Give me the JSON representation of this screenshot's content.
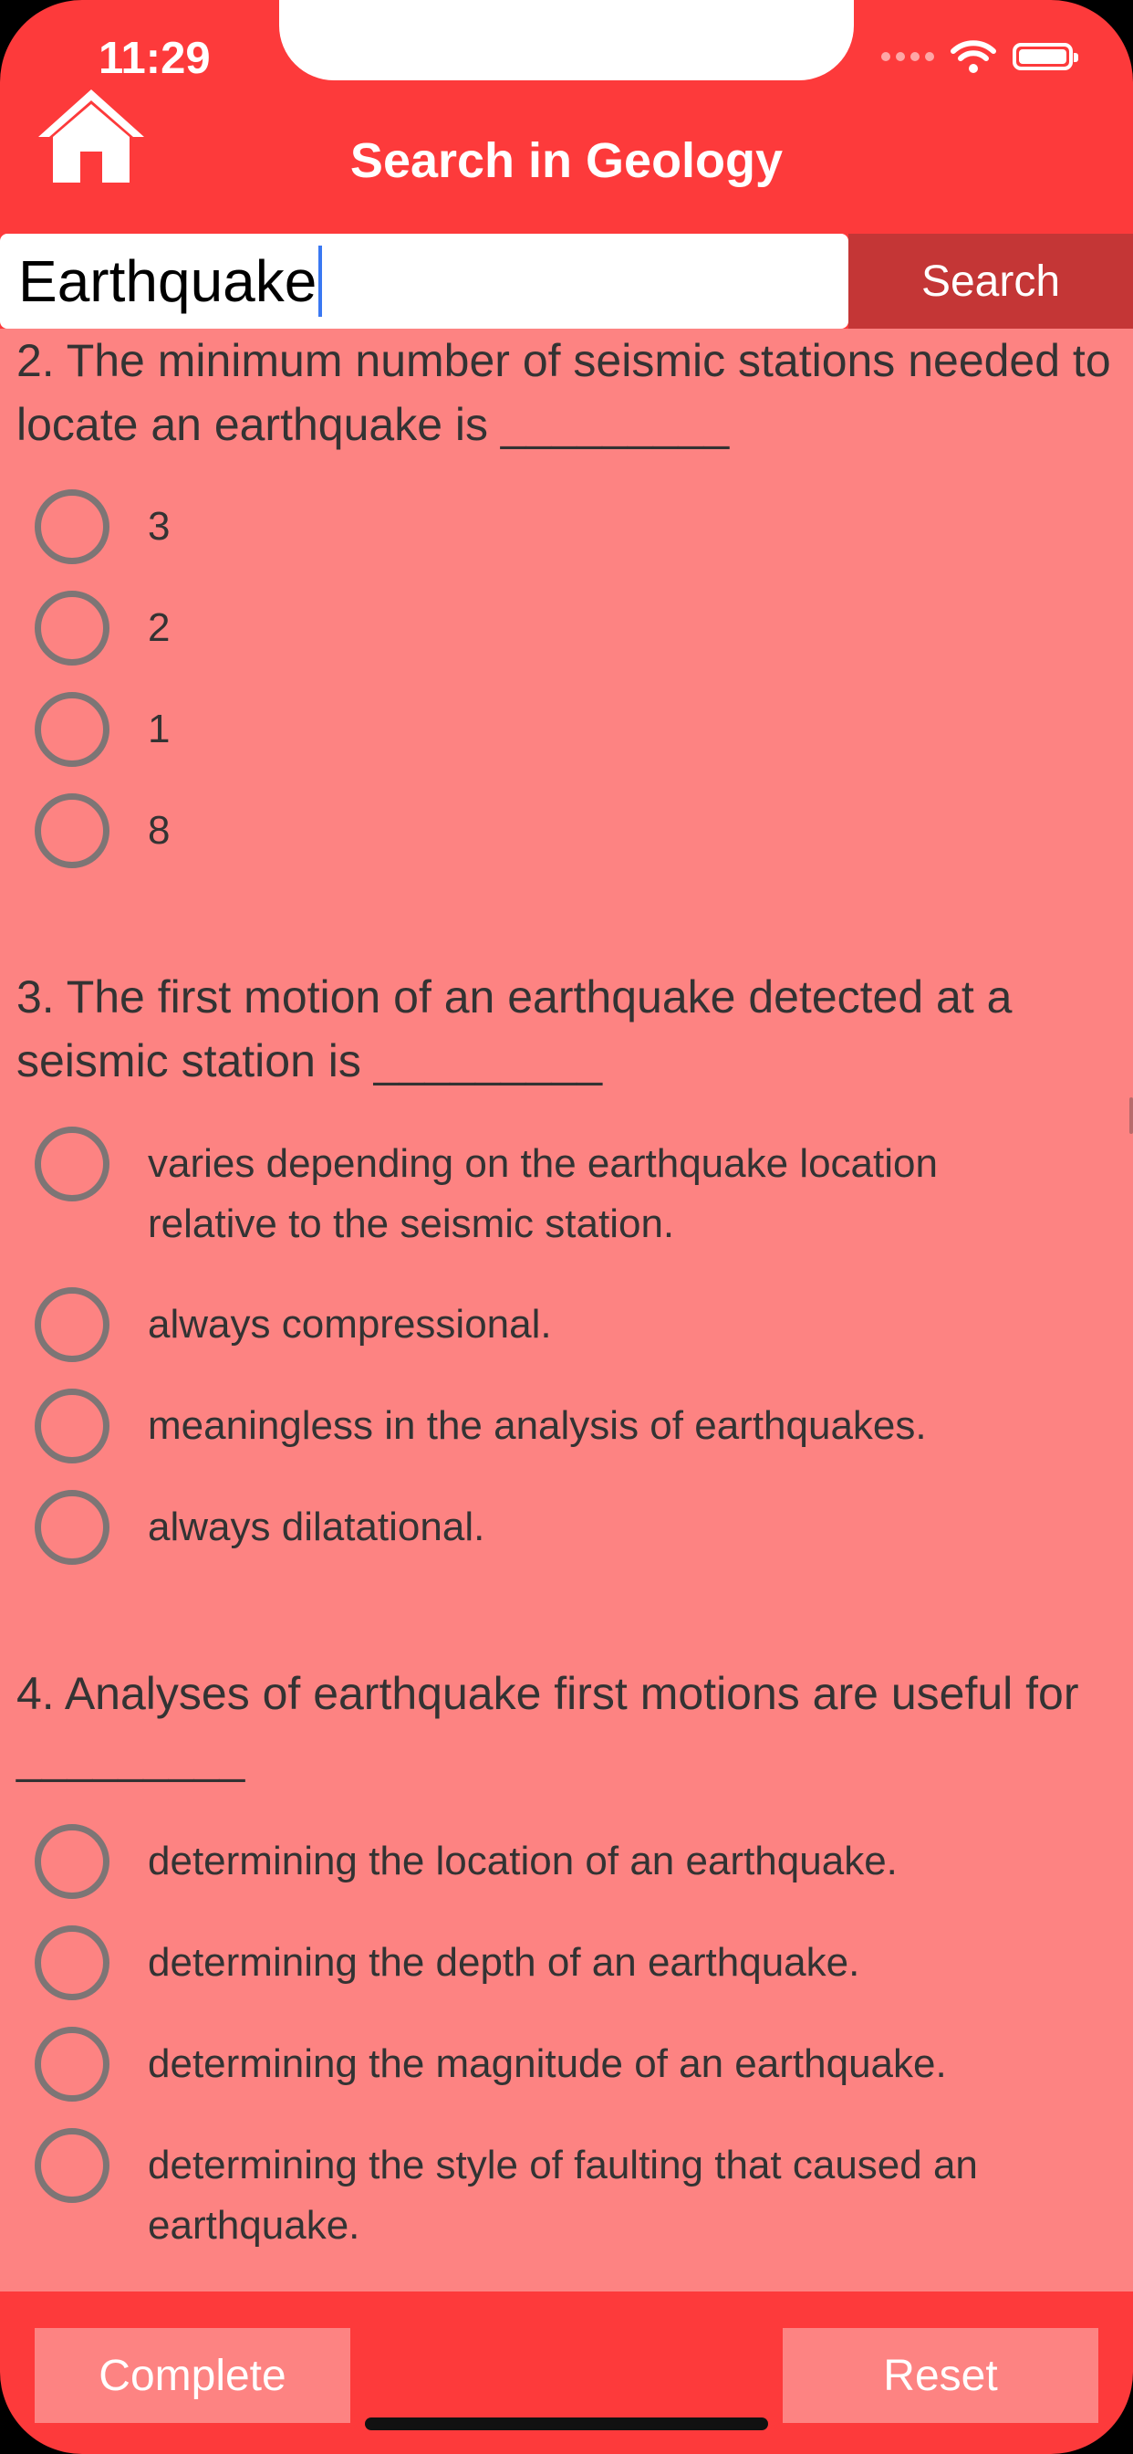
{
  "status_bar": {
    "time": "11:29"
  },
  "nav": {
    "title": "Search in Geology",
    "home_icon": "home-icon"
  },
  "search": {
    "value": "Earthquake",
    "button_label": "Search"
  },
  "questions": [
    {
      "text": "2. The minimum number of seismic stations needed to locate an earthquake is _________",
      "options": [
        "3",
        "2",
        "1",
        "8"
      ]
    },
    {
      "text": "3. The first motion of an earthquake detected at a seismic station is _________",
      "options": [
        "varies depending on the earthquake location relative to the seismic station.",
        "always compressional.",
        "meaningless in the analysis of earthquakes.",
        "always dilatational."
      ]
    },
    {
      "text": "4. Analyses of earthquake first motions are useful for _________",
      "options": [
        "determining the location of an earthquake.",
        "determining the depth of an earthquake.",
        "determining the magnitude of an earthquake.",
        "determining the style of faulting that caused an earthquake."
      ]
    }
  ],
  "footer": {
    "complete_label": "Complete",
    "reset_label": "Reset"
  },
  "colors": {
    "header": "#fd3a3b",
    "content_bg": "#fd8382",
    "search_button": "#c43636",
    "radio_border": "#7d7575"
  }
}
